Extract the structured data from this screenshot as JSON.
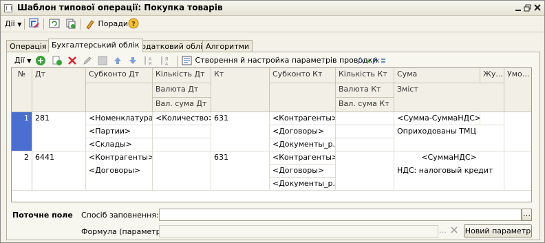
{
  "window": {
    "title": "Шаблон типової операції: Покупка товарів"
  },
  "toolbar": {
    "actions_label": "Дії",
    "tips_label": "Поради"
  },
  "tabs": [
    {
      "label": "Операція"
    },
    {
      "label": "Бухгалтерський облік"
    },
    {
      "label": "Податковий облік"
    },
    {
      "label": "Алгоритми"
    }
  ],
  "subbar": {
    "actions_label": "Дії",
    "create_params_label": "Створення й настройка параметрів проводки"
  },
  "grid": {
    "headers": {
      "num": "№",
      "dt": "Дт",
      "subkonto_dt": "Субконто Дт",
      "qty_dt": "Кількість Дт",
      "currency_dt": "Валюта Дт",
      "val_sum_dt": "Вал. сума Дт",
      "kt": "Кт",
      "subkonto_kt": "Субконто Кт",
      "qty_kt": "Кількість Кт",
      "currency_kt": "Валюта Кт",
      "val_sum_kt": "Вал. сума Кт",
      "sum": "Сума",
      "content": "Зміст",
      "journal": "Жу...",
      "condition": "Умо..."
    },
    "rows": [
      {
        "num": "1",
        "dt": "281",
        "subkonto_dt": [
          "<Номенклатура>",
          "<Партии>",
          "<Склады>"
        ],
        "qty_dt": "<Количество>",
        "kt": "631",
        "subkonto_kt": [
          "<Контрагенты>",
          "<Договоры>",
          "<Документы_р..."
        ],
        "sum": "<Сумма-СуммаНДС>",
        "content": "Оприходованы ТМЦ"
      },
      {
        "num": "2",
        "dt": "6441",
        "subkonto_dt": [
          "<Контрагенты>",
          "<Договоры>"
        ],
        "qty_dt": "",
        "kt": "631",
        "subkonto_kt": [
          "<Контрагенты>",
          "<Договоры>",
          "<Документы_р..."
        ],
        "sum": "<СуммаНДС>",
        "content": "НДС: налоговый кредит"
      }
    ]
  },
  "current_field": {
    "label": "Поточне поле",
    "fill_method_label": "Спосіб заповнення:",
    "fill_method_value": "",
    "formula_label": "Формула (параметр):",
    "formula_value": "",
    "new_param_button": "Новий параметр"
  }
}
